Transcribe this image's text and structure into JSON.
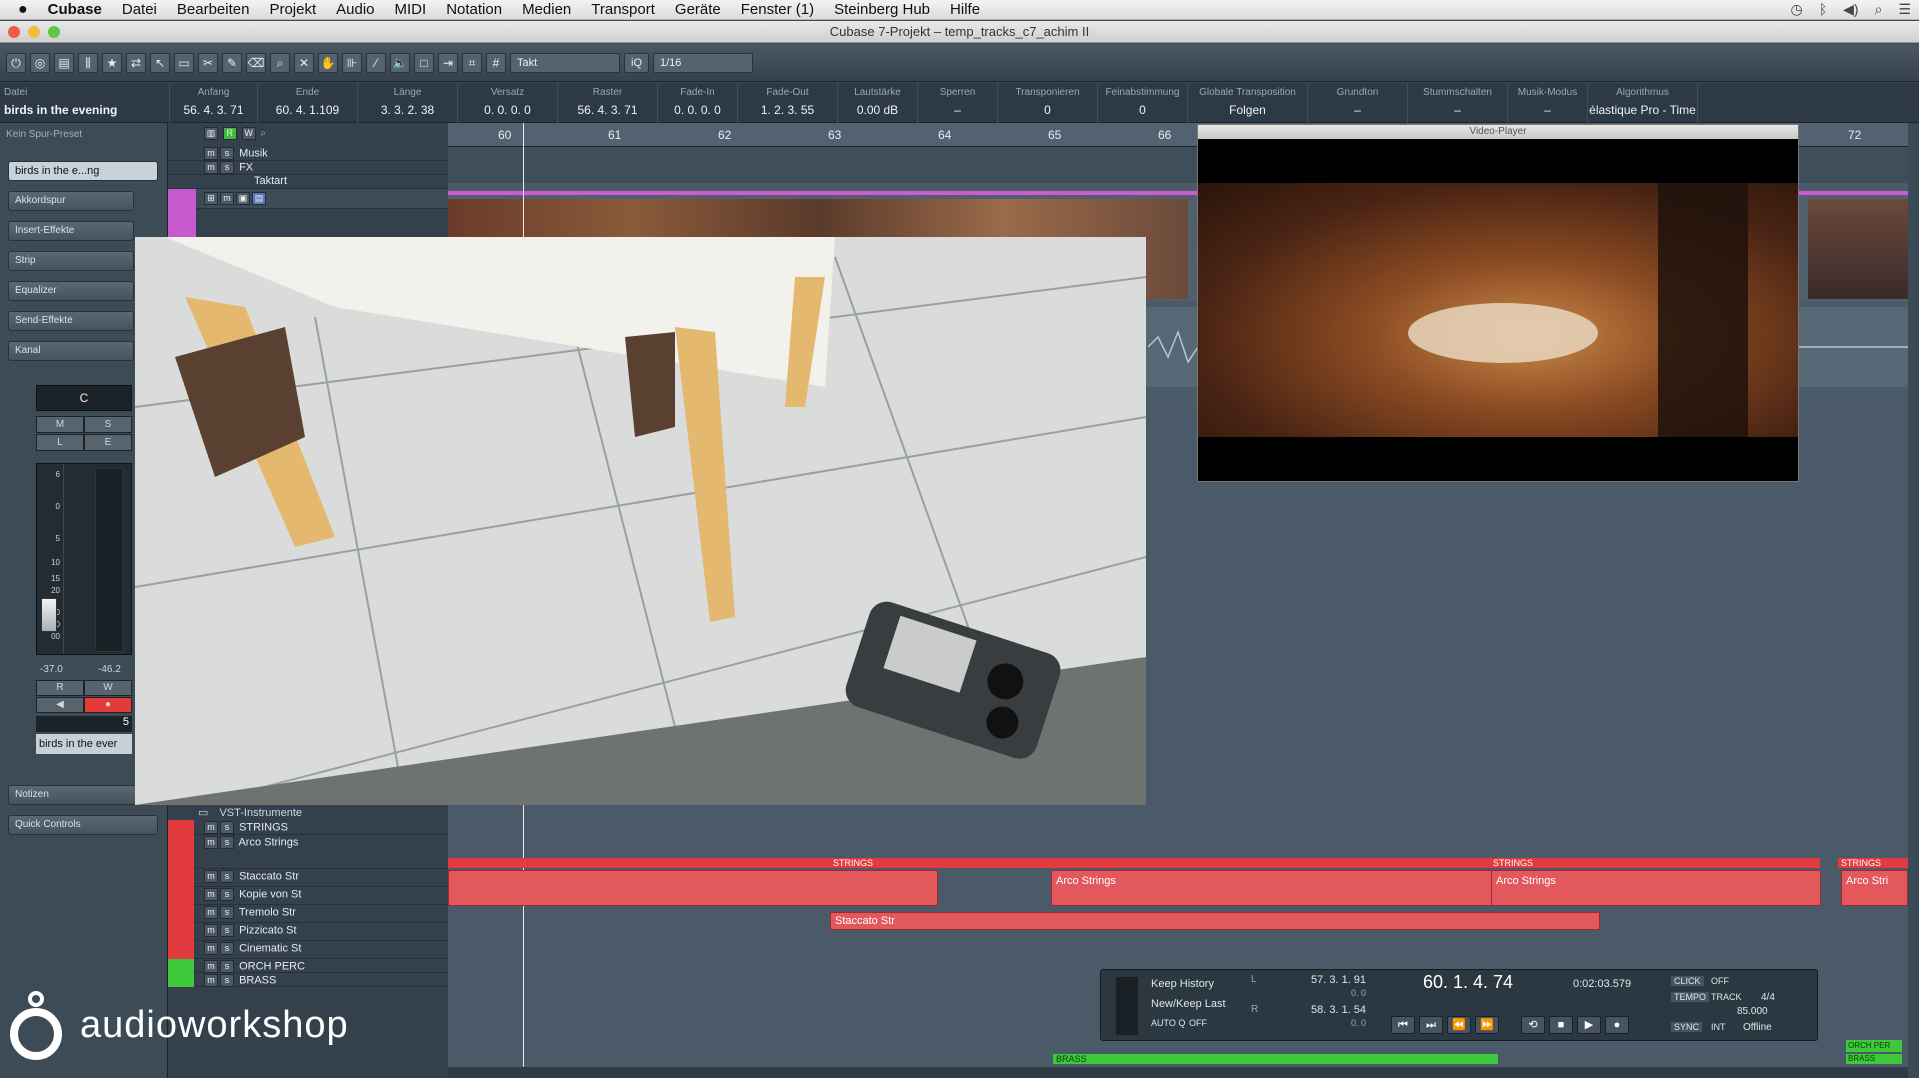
{
  "menubar": {
    "apple": "",
    "app": "Cubase",
    "items": [
      "Datei",
      "Bearbeiten",
      "Projekt",
      "Audio",
      "MIDI",
      "Notation",
      "Medien",
      "Transport",
      "Geräte",
      "Fenster (1)",
      "Steinberg Hub",
      "Hilfe"
    ]
  },
  "window": {
    "title": "Cubase 7-Projekt – temp_tracks_c7_achim II"
  },
  "toolbar": {
    "snap_label": "Takt",
    "iq_label": "iQ",
    "quantize_label": "1/16"
  },
  "infoline": {
    "file_label": "Datei",
    "file_value": "birds in the evening",
    "columns": [
      {
        "label": "Anfang",
        "value": "56. 4. 3. 71"
      },
      {
        "label": "Ende",
        "value": "60. 4. 1.109"
      },
      {
        "label": "Länge",
        "value": "3. 3. 2. 38"
      },
      {
        "label": "Versatz",
        "value": "0. 0. 0. 0"
      },
      {
        "label": "Raster",
        "value": "56. 4. 3. 71"
      },
      {
        "label": "Fade-In",
        "value": "0. 0. 0. 0"
      },
      {
        "label": "Fade-Out",
        "value": "1. 2. 3. 55"
      },
      {
        "label": "Lautstärke",
        "value": "0.00 dB"
      },
      {
        "label": "Sperren",
        "value": "–"
      },
      {
        "label": "Transponieren",
        "value": "0"
      },
      {
        "label": "Feinabstimmung",
        "value": "0"
      },
      {
        "label": "Globale Transposition",
        "value": "Folgen"
      },
      {
        "label": "Grundton",
        "value": "–"
      },
      {
        "label": "Stummschalten",
        "value": "–"
      },
      {
        "label": "Musik-Modus",
        "value": "–"
      },
      {
        "label": "Algorithmus",
        "value": "élastique Pro - Time"
      }
    ]
  },
  "inspector": {
    "preset": "Kein Spur-Preset",
    "track_name": "birds in the e...ng",
    "sections": [
      "Akkordspur",
      "Insert-Effekte",
      "Strip",
      "Equalizer",
      "Send-Effekte",
      "Kanal"
    ],
    "channel_letter": "C",
    "buttons": [
      "M",
      "S",
      "L",
      "E",
      "R",
      "W"
    ],
    "meter_scale": [
      "6",
      "0",
      "5",
      "10",
      "15",
      "20",
      "30",
      "40",
      "00"
    ],
    "level_left": "-37.0",
    "level_right": "-46.2",
    "channel_number": "5",
    "channel_name": "birds in the ever",
    "notes": "Notizen",
    "quick_controls": "Quick Controls"
  },
  "tracks_top": [
    {
      "name": "Musik"
    },
    {
      "name": "FX"
    },
    {
      "name": "Taktart"
    }
  ],
  "tracks_bottom": {
    "folder": "VST-Instrumente",
    "items": [
      {
        "name": "STRINGS"
      },
      {
        "name": "Arco Strings"
      },
      {
        "name": "Staccato Str"
      },
      {
        "name": "Kopie von St"
      },
      {
        "name": "Tremolo Str"
      },
      {
        "name": "Pizzicato St"
      },
      {
        "name": "Cinematic St"
      },
      {
        "name": "ORCH PERC"
      },
      {
        "name": "BRASS"
      }
    ]
  },
  "ruler": {
    "bars": [
      "60",
      "61",
      "62",
      "63",
      "64",
      "65",
      "66",
      "72"
    ]
  },
  "video_player": {
    "title": "Video-Player"
  },
  "events": {
    "strings_lane": "STRINGS",
    "arco1": "Arco Strings",
    "arco2": "Arco Strings",
    "arco3": "Arco Stri",
    "staccato": "Staccato Str",
    "brass": "BRASS",
    "orch_perc": "ORCH PER",
    "brass_right": "BRASS"
  },
  "transport": {
    "history_label": "Keep History",
    "record_mode": "New/Keep Last",
    "auto_q": "AUTO Q",
    "auto_q_value": "OFF",
    "left_locator": "57. 3. 1. 91",
    "left_sub": "0. 0",
    "right_locator": "58. 3. 1. 54",
    "right_sub": "0. 0",
    "position_bars": "60. 1. 4. 74",
    "position_time": "0:02:03.579",
    "click_label": "CLICK",
    "click_value": "OFF",
    "tempo_label": "TEMPO",
    "tempo_mode": "TRACK",
    "signature": "4/4",
    "tempo_value": "85.000",
    "sync_label": "SYNC",
    "sync_mode": "INT",
    "sync_status": "Offline"
  },
  "logo": {
    "text": "audioworkshop"
  },
  "colors": {
    "accent_red": "#d9363e",
    "event_red": "#e0545a",
    "brass_green": "#3ec93a",
    "video_pink": "#cf5bd2"
  }
}
